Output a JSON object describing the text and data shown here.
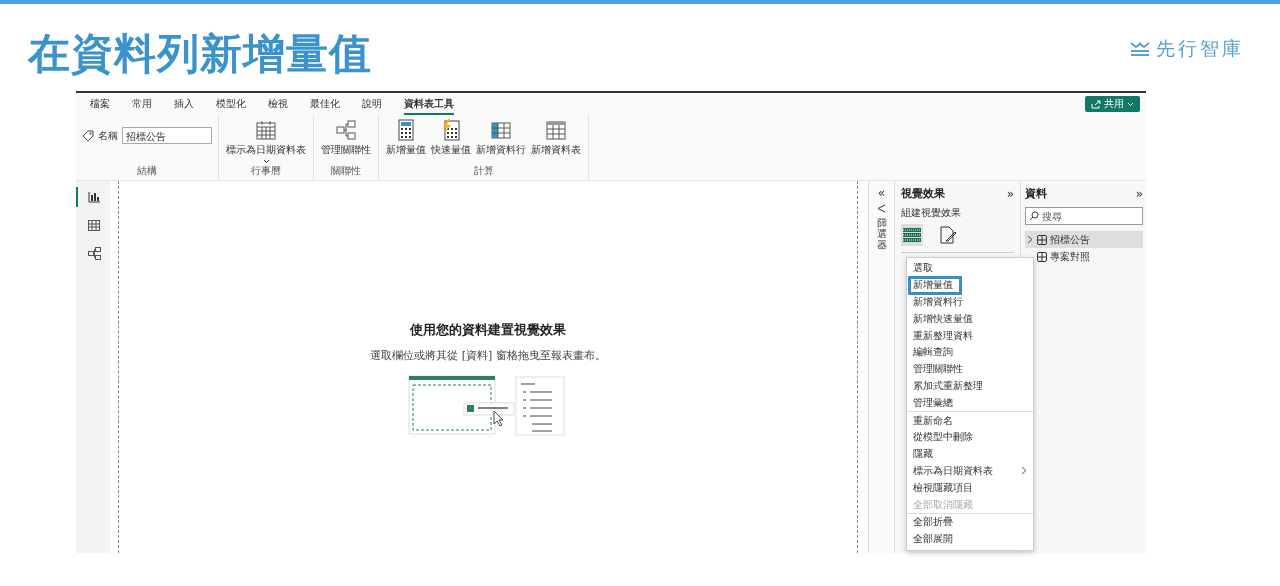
{
  "slide": {
    "title": "在資料列新增量值",
    "logo": "先行智庫"
  },
  "ribbon": {
    "tabs": [
      {
        "label": "檔案",
        "selected": false
      },
      {
        "label": "常用",
        "selected": false
      },
      {
        "label": "插入",
        "selected": false
      },
      {
        "label": "模型化",
        "selected": false
      },
      {
        "label": "檢視",
        "selected": false
      },
      {
        "label": "最佳化",
        "selected": false
      },
      {
        "label": "說明",
        "selected": false
      },
      {
        "label": "資料表工具",
        "selected": true
      }
    ],
    "share_button": "共用",
    "name_field": {
      "label": "名稱",
      "value": "招標公告"
    },
    "groups": [
      {
        "label": "結構"
      },
      {
        "label": "行事曆",
        "buttons": [
          {
            "label": "標示為日期資料表",
            "kind": "calendar",
            "dropdown": true
          }
        ]
      },
      {
        "label": "關聯性",
        "buttons": [
          {
            "label": "管理關聯性",
            "kind": "relations",
            "dropdown": false
          }
        ]
      },
      {
        "label": "計算",
        "buttons": [
          {
            "label": "新增量值",
            "kind": "calculator",
            "dropdown": false
          },
          {
            "label": "快速量值",
            "kind": "quick",
            "dropdown": false
          },
          {
            "label": "新增資料行",
            "kind": "column",
            "dropdown": false
          },
          {
            "label": "新增資料表",
            "kind": "table",
            "dropdown": false
          }
        ]
      }
    ]
  },
  "rail": [
    {
      "kind": "report",
      "selected": true
    },
    {
      "kind": "table",
      "selected": false
    },
    {
      "kind": "model",
      "selected": false
    }
  ],
  "canvas": {
    "heading": "使用您的資料建置視覺效果",
    "hint": "選取欄位或將其從 [資料] 窗格拖曳至報表畫布。"
  },
  "filters": {
    "expand": "«",
    "label": "篩選器"
  },
  "visuals": {
    "title": "視覺效果",
    "collapse": "»",
    "subtitle": "組建視覺效果"
  },
  "data": {
    "title": "資料",
    "collapse": "»",
    "search": {
      "placeholder": "搜尋"
    },
    "tables": [
      {
        "name": "招標公告",
        "selected": true
      },
      {
        "name": "專案對照",
        "selected": false
      }
    ]
  },
  "context_menu": {
    "groups": [
      [
        {
          "label": "選取",
          "selected": false,
          "disabled": false,
          "submenu": false
        },
        {
          "label": "新增量值",
          "selected": true,
          "disabled": false,
          "submenu": false
        },
        {
          "label": "新增資料行",
          "selected": false,
          "disabled": false,
          "submenu": false
        },
        {
          "label": "新增快速量值",
          "selected": false,
          "disabled": false,
          "submenu": false
        },
        {
          "label": "重新整理資料",
          "selected": false,
          "disabled": false,
          "submenu": false
        },
        {
          "label": "編輯查詢",
          "selected": false,
          "disabled": false,
          "submenu": false
        },
        {
          "label": "管理關聯性",
          "selected": false,
          "disabled": false,
          "submenu": false
        },
        {
          "label": "累加式重新整理",
          "selected": false,
          "disabled": false,
          "submenu": false
        },
        {
          "label": "管理彙總",
          "selected": false,
          "disabled": false,
          "submenu": false
        }
      ],
      [
        {
          "label": "重新命名",
          "selected": false,
          "disabled": false,
          "submenu": false
        },
        {
          "label": "從模型中刪除",
          "selected": false,
          "disabled": false,
          "submenu": false
        },
        {
          "label": "隱藏",
          "selected": false,
          "disabled": false,
          "submenu": false
        },
        {
          "label": "標示為日期資料表",
          "selected": false,
          "disabled": false,
          "submenu": true
        },
        {
          "label": "檢視隱藏項目",
          "selected": false,
          "disabled": false,
          "submenu": false
        },
        {
          "label": "全部取消隱藏",
          "selected": false,
          "disabled": true,
          "submenu": false
        }
      ],
      [
        {
          "label": "全部折疊",
          "selected": false,
          "disabled": false,
          "submenu": false
        },
        {
          "label": "全部展開",
          "selected": false,
          "disabled": false,
          "submenu": false
        }
      ]
    ]
  }
}
